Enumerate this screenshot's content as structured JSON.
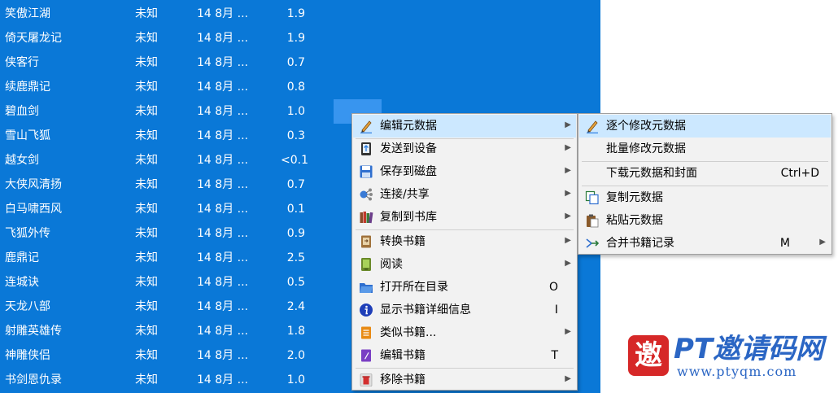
{
  "book_list": {
    "rows": [
      {
        "title": "笑傲江湖",
        "author": "未知",
        "date": "14 8月 ...",
        "size": "1.9"
      },
      {
        "title": "倚天屠龙记",
        "author": "未知",
        "date": "14 8月 ...",
        "size": "1.9"
      },
      {
        "title": "侠客行",
        "author": "未知",
        "date": "14 8月 ...",
        "size": "0.7"
      },
      {
        "title": "续鹿鼎记",
        "author": "未知",
        "date": "14 8月 ...",
        "size": "0.8"
      },
      {
        "title": "碧血剑",
        "author": "未知",
        "date": "14 8月 ...",
        "size": "1.0"
      },
      {
        "title": "雪山飞狐",
        "author": "未知",
        "date": "14 8月 ...",
        "size": "0.3"
      },
      {
        "title": "越女剑",
        "author": "未知",
        "date": "14 8月 ...",
        "size": "<0.1"
      },
      {
        "title": "大侠风清扬",
        "author": "未知",
        "date": "14 8月 ...",
        "size": "0.7"
      },
      {
        "title": "白马啸西风",
        "author": "未知",
        "date": "14 8月 ...",
        "size": "0.1"
      },
      {
        "title": "飞狐外传",
        "author": "未知",
        "date": "14 8月 ...",
        "size": "0.9"
      },
      {
        "title": "鹿鼎记",
        "author": "未知",
        "date": "14 8月 ...",
        "size": "2.5"
      },
      {
        "title": "连城诀",
        "author": "未知",
        "date": "14 8月 ...",
        "size": "0.5"
      },
      {
        "title": "天龙八部",
        "author": "未知",
        "date": "14 8月 ...",
        "size": "2.4"
      },
      {
        "title": "射雕英雄传",
        "author": "未知",
        "date": "14 8月 ...",
        "size": "1.8"
      },
      {
        "title": "神雕侠侣",
        "author": "未知",
        "date": "14 8月 ...",
        "size": "2.0"
      },
      {
        "title": "书剑恩仇录",
        "author": "未知",
        "date": "14 8月 ...",
        "size": "1.0"
      }
    ]
  },
  "context_menu": {
    "items": [
      {
        "label": "编辑元数据",
        "shortcut": "",
        "has_submenu": true,
        "icon": "pencil-icon"
      },
      {
        "label": "发送到设备",
        "shortcut": "",
        "has_submenu": true,
        "icon": "device-icon"
      },
      {
        "label": "保存到磁盘",
        "shortcut": "",
        "has_submenu": true,
        "icon": "floppy-icon"
      },
      {
        "label": "连接/共享",
        "shortcut": "",
        "has_submenu": true,
        "icon": "network-icon"
      },
      {
        "label": "复制到书库",
        "shortcut": "",
        "has_submenu": true,
        "icon": "library-icon"
      },
      {
        "label": "转换书籍",
        "shortcut": "",
        "has_submenu": true,
        "icon": "convert-icon"
      },
      {
        "label": "阅读",
        "shortcut": "",
        "has_submenu": true,
        "icon": "reader-icon"
      },
      {
        "label": "打开所在目录",
        "shortcut": "O",
        "has_submenu": false,
        "icon": "folder-icon"
      },
      {
        "label": "显示书籍详细信息",
        "shortcut": "I",
        "has_submenu": false,
        "icon": "info-icon"
      },
      {
        "label": "类似书籍...",
        "shortcut": "",
        "has_submenu": true,
        "icon": "similar-books-icon"
      },
      {
        "label": "编辑书籍",
        "shortcut": "T",
        "has_submenu": false,
        "icon": "edit-book-icon"
      },
      {
        "label": "移除书籍",
        "shortcut": "",
        "has_submenu": true,
        "icon": "trash-icon"
      }
    ]
  },
  "sub_menu": {
    "items": [
      {
        "label": "逐个修改元数据",
        "shortcut": "",
        "has_submenu": false,
        "icon": "pencil-icon"
      },
      {
        "label": "批量修改元数据",
        "shortcut": "",
        "has_submenu": false,
        "icon": ""
      },
      {
        "label": "下载元数据和封面",
        "shortcut": "Ctrl+D",
        "has_submenu": false,
        "icon": ""
      },
      {
        "label": "复制元数据",
        "shortcut": "",
        "has_submenu": false,
        "icon": "copy-icon"
      },
      {
        "label": "粘贴元数据",
        "shortcut": "",
        "has_submenu": false,
        "icon": "paste-icon"
      },
      {
        "label": "合并书籍记录",
        "shortcut": "M",
        "has_submenu": true,
        "icon": "merge-icon"
      }
    ]
  },
  "submenu_arrow": "▶",
  "watermark": {
    "logo_char": "邀",
    "title": "PT邀请码网",
    "url": "www.ptyqm.com"
  },
  "colors": {
    "selection_blue": "#0a78d7",
    "menu_highlight": "#cce8ff",
    "menu_bg": "#f2f2f2",
    "watermark_blue": "#2b66c4"
  }
}
